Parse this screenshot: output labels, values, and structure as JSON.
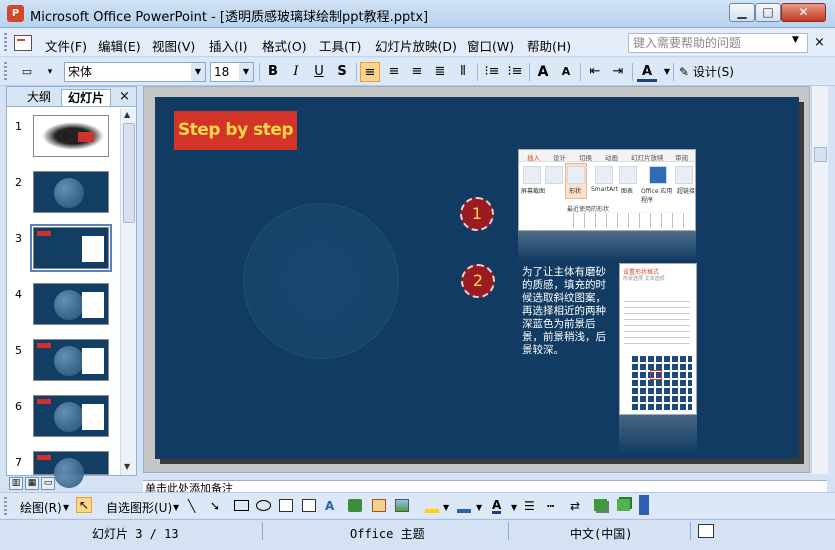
{
  "window": {
    "title": "Microsoft Office PowerPoint - [透明质感玻璃球绘制ppt教程.pptx]",
    "app_icon": "powerpoint-icon",
    "minimize_label": "▁",
    "maximize_label": "□",
    "close_label": "✕"
  },
  "menubar": {
    "items": [
      "文件(F)",
      "编辑(E)",
      "视图(V)",
      "插入(I)",
      "格式(O)",
      "工具(T)",
      "幻灯片放映(D)",
      "窗口(W)",
      "帮助(H)"
    ],
    "help_placeholder": "键入需要帮助的问题",
    "close_label": "×"
  },
  "toolbar": {
    "font_name": "宋体",
    "font_size": "18",
    "bold": "B",
    "italic": "I",
    "underline": "U",
    "shadow": "S",
    "grow_font": "A",
    "shrink_font": "A",
    "font_color": "A",
    "design_label": "设计(S)"
  },
  "left_panel": {
    "tab_outline": "大纲",
    "tab_slides": "幻灯片",
    "close_label": "×",
    "slide_numbers": [
      "1",
      "2",
      "3",
      "4",
      "5",
      "6",
      "7"
    ]
  },
  "slide": {
    "badge": "Step by step",
    "step1": "1",
    "step2": "2",
    "description": "为了让主体有磨砂的质感，填充的时候选取斜纹图案，再选择相近的两种深蓝色为前景后景，前景稍浅，后景较深。",
    "shot1_tabs": [
      "插入",
      "设计",
      "切换",
      "动画",
      "幻灯片放映",
      "审阅"
    ],
    "shot1_buttons": [
      "屏幕截图",
      "形状",
      "SmartArt",
      "图表",
      "Office 应用程序",
      "超链接"
    ],
    "shot1_recent": "最近使用的形状",
    "shot2_title": "设置形状格式",
    "shot2_sub": "形状选项   文本选项"
  },
  "notes": {
    "placeholder": "单击此处添加备注"
  },
  "drawbar": {
    "draw_label": "绘图(R)",
    "autoshapes_label": "自选图形(U)"
  },
  "statusbar": {
    "slide_info": "幻灯片 3 / 13",
    "theme": "Office 主题",
    "language": "中文(中国)"
  },
  "colors": {
    "slide_bg": "#113b62",
    "badge_bg": "#d43327",
    "badge_text": "#ffd94a",
    "step_circle": "#9b1b22"
  }
}
